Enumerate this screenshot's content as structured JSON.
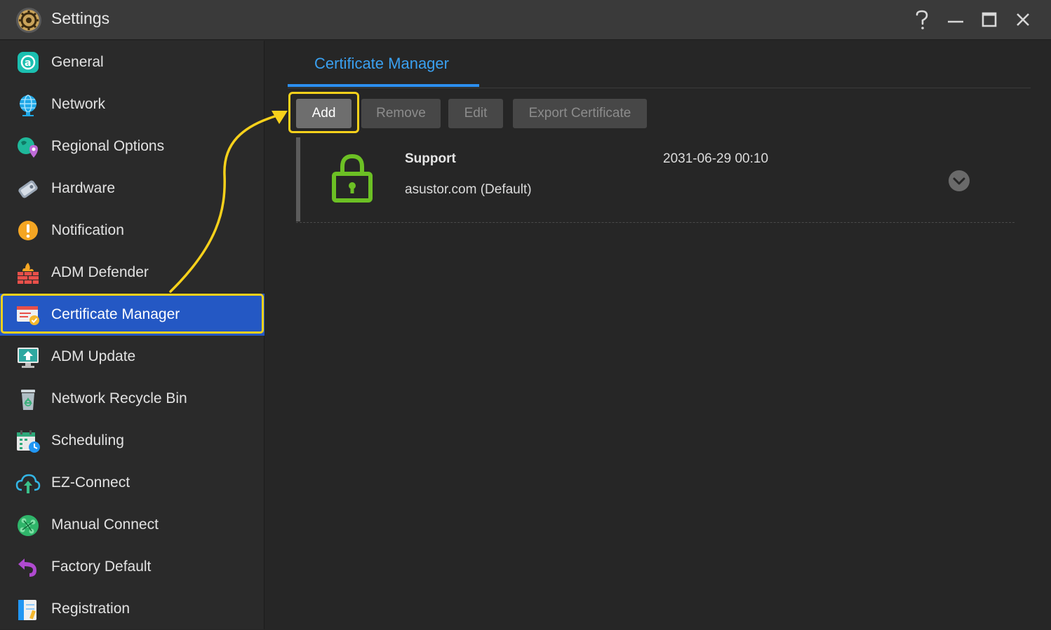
{
  "window": {
    "title": "Settings",
    "controls": [
      "help-icon",
      "minimize-icon",
      "maximize-icon",
      "close-icon"
    ]
  },
  "sidebar": {
    "items": [
      {
        "label": "General",
        "icon": "general-icon"
      },
      {
        "label": "Network",
        "icon": "globe-icon"
      },
      {
        "label": "Regional Options",
        "icon": "regional-icon"
      },
      {
        "label": "Hardware",
        "icon": "hardware-icon"
      },
      {
        "label": "Notification",
        "icon": "notification-icon"
      },
      {
        "label": "ADM Defender",
        "icon": "firewall-icon"
      },
      {
        "label": "Certificate Manager",
        "icon": "certificate-icon",
        "active": true
      },
      {
        "label": "ADM Update",
        "icon": "update-icon"
      },
      {
        "label": "Network Recycle Bin",
        "icon": "recycle-bin-icon"
      },
      {
        "label": "Scheduling",
        "icon": "calendar-icon"
      },
      {
        "label": "EZ-Connect",
        "icon": "cloud-icon"
      },
      {
        "label": "Manual Connect",
        "icon": "connect-icon"
      },
      {
        "label": "Factory Default",
        "icon": "undo-icon"
      },
      {
        "label": "Registration",
        "icon": "registration-icon"
      }
    ]
  },
  "main": {
    "tab": "Certificate Manager",
    "toolbar": {
      "add": "Add",
      "remove": "Remove",
      "edit": "Edit",
      "export": "Export Certificate"
    },
    "certificates": [
      {
        "name": "Support",
        "domain": "asustor.com (Default)",
        "expires": "2031-06-29 00:10",
        "icon": "lock-icon"
      }
    ]
  },
  "colors": {
    "accent": "#2c8ff0",
    "active_item": "#2458c4",
    "highlight": "#f7d11b",
    "lock": "#6cc024"
  }
}
